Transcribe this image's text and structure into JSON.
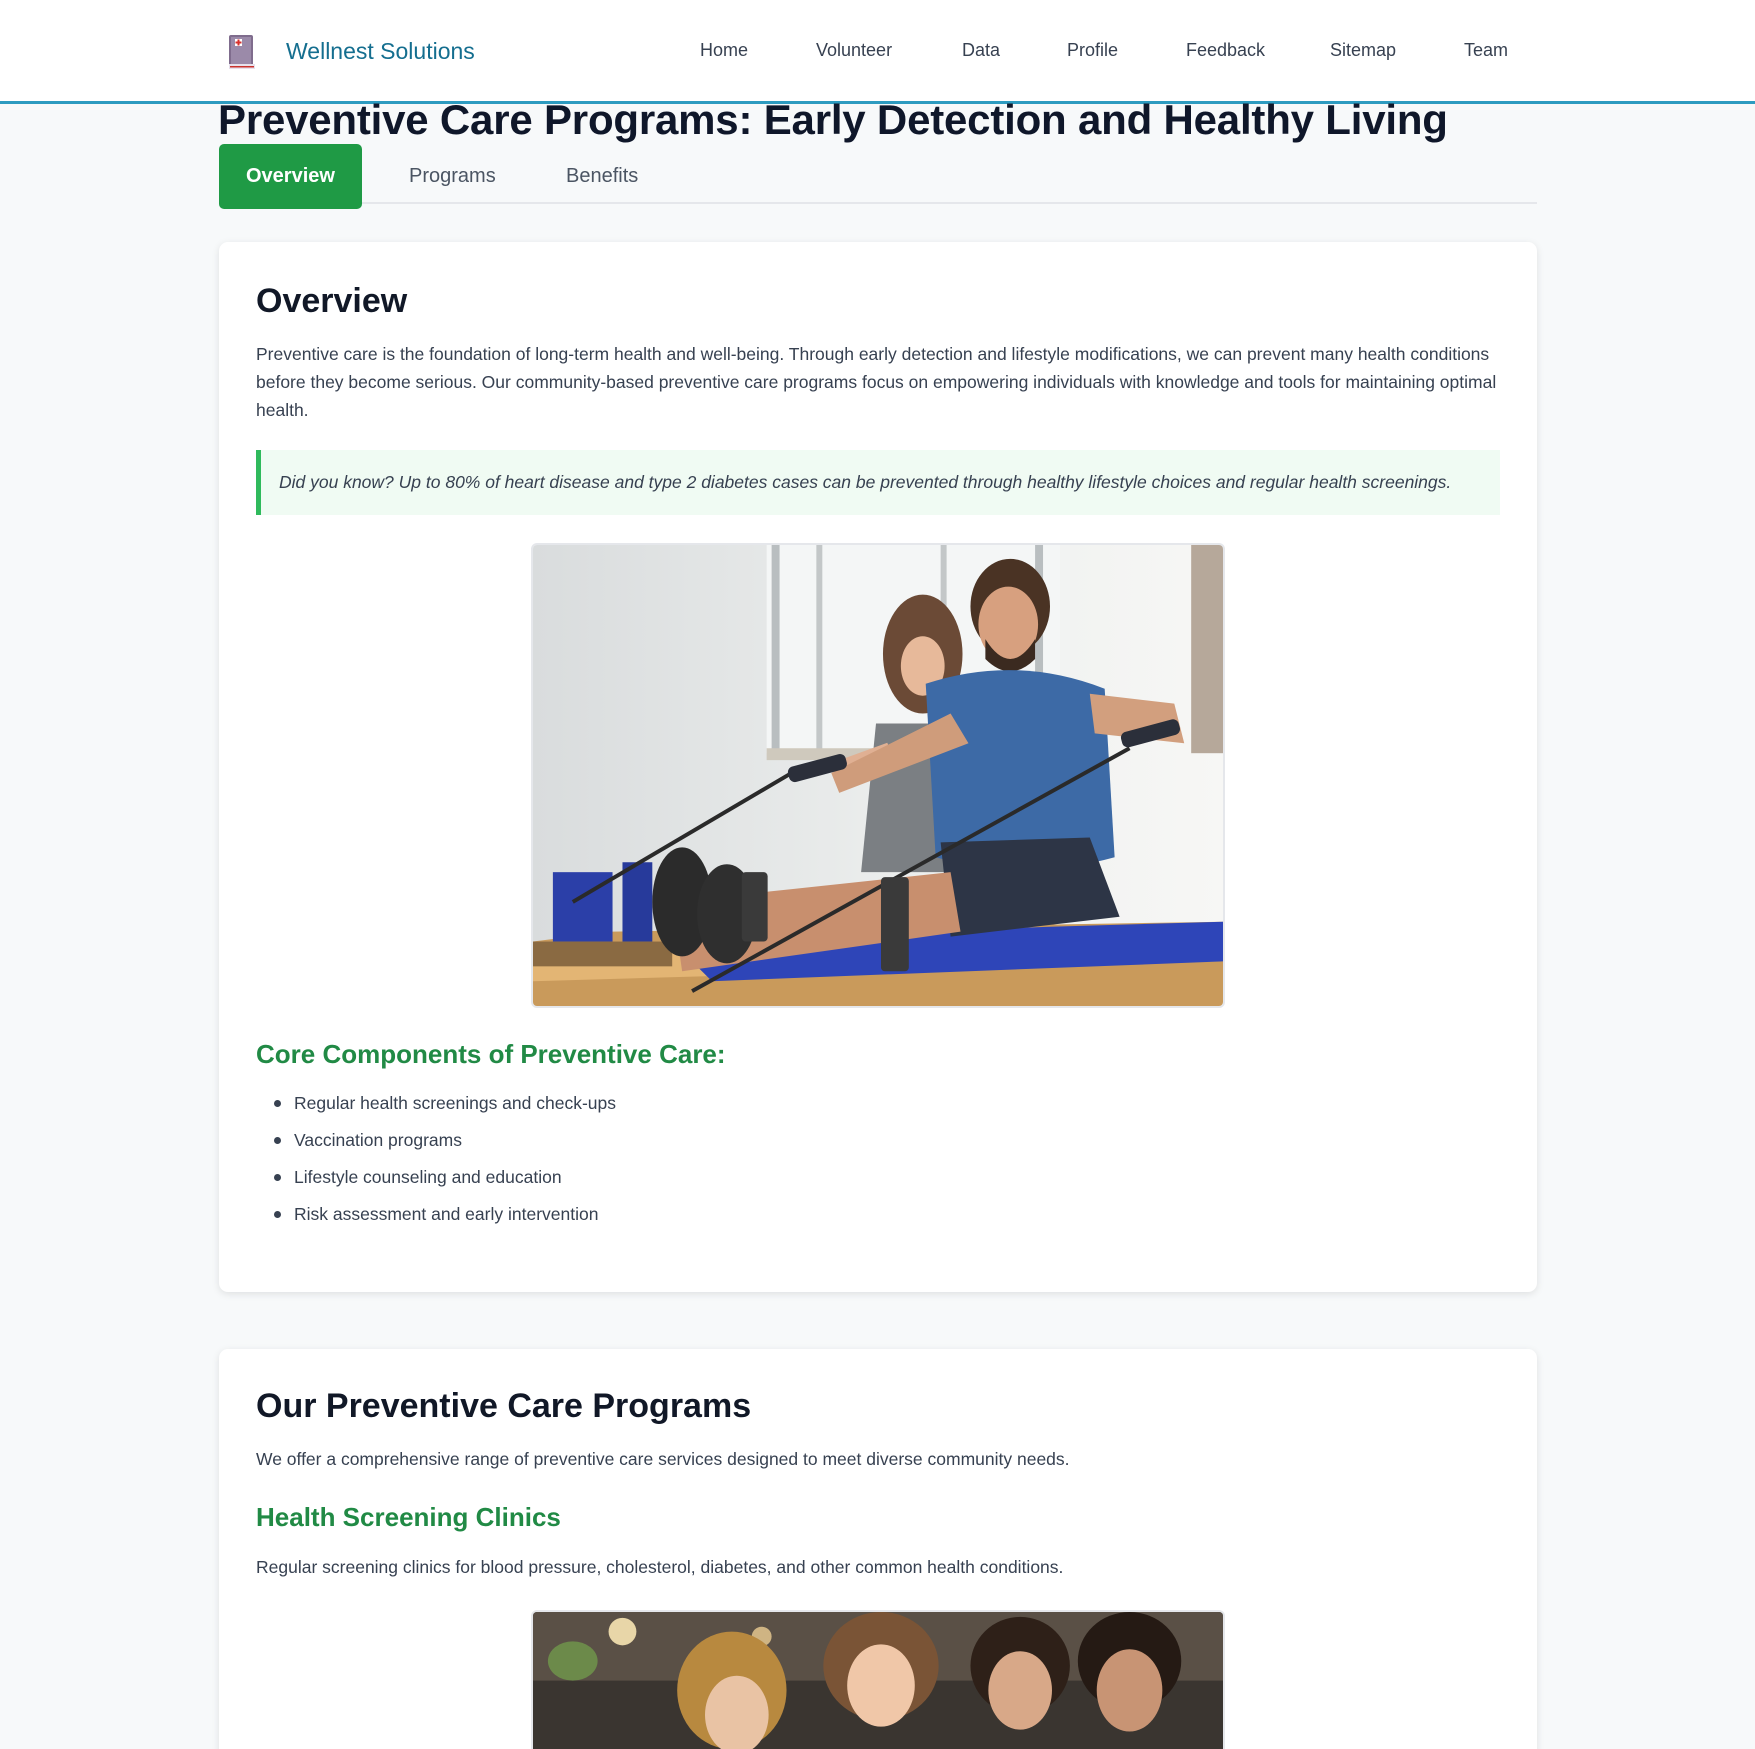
{
  "header": {
    "brand_name": "Wellnest Solutions",
    "nav": [
      "Home",
      "Volunteer",
      "Data",
      "Profile",
      "Feedback",
      "Sitemap",
      "Team"
    ]
  },
  "page": {
    "title": "Preventive Care Programs: Early Detection and Healthy Living",
    "tabs": [
      "Overview",
      "Programs",
      "Benefits"
    ],
    "active_tab": "Overview"
  },
  "overview": {
    "heading": "Overview",
    "intro": "Preventive care is the foundation of long-term health and well-being. Through early detection and lifestyle modifications, we can prevent many health conditions before they become serious. Our community-based preventive care programs focus on empowering individuals with knowledge and tools for maintaining optimal health.",
    "callout": "Did you know? Up to 80% of heart disease and type 2 diabetes cases can be prevented through healthy lifestyle choices and regular health screenings.",
    "components_heading": "Core Components of Preventive Care:",
    "components": [
      "Regular health screenings and check-ups",
      "Vaccination programs",
      "Lifestyle counseling and education",
      "Risk assessment and early intervention"
    ]
  },
  "programs": {
    "heading": "Our Preventive Care Programs",
    "intro": "We offer a comprehensive range of preventive care services designed to meet diverse community needs.",
    "screening_heading": "Health Screening Clinics",
    "screening_text": "Regular screening clinics for blood pressure, cholesterol, diabetes, and other common health conditions."
  },
  "colors": {
    "brand": "#146e8f",
    "accent_green": "#1f9a45",
    "header_rule": "#2d9bc0"
  },
  "icons": {
    "logo": "medical-book-icon"
  }
}
